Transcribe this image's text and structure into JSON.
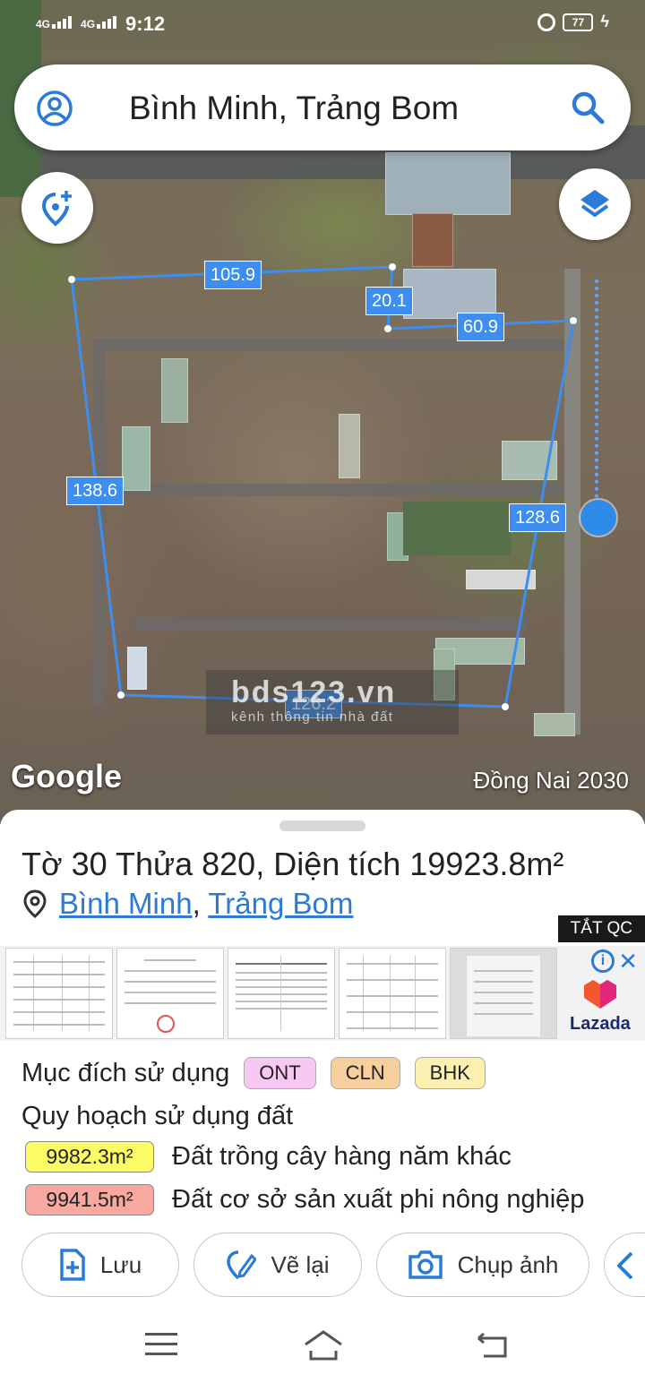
{
  "status": {
    "network1": "4G",
    "network2": "4G",
    "time": "9:12",
    "battery": "77"
  },
  "search": {
    "query": "Bình Minh, Trảng Bom"
  },
  "map": {
    "measurements": [
      "105.9",
      "20.1",
      "60.9",
      "138.6",
      "128.6",
      "126.2"
    ],
    "watermark_main": "bds123.vn",
    "watermark_sub": "kênh thông tin nhà đất",
    "logo": "Google",
    "year_label": "Đồng Nai 2030",
    "boundary_color": "#3d8ef0"
  },
  "parcel": {
    "title": "Tờ 30 Thửa 820, Diện tích 19923.8m²",
    "ward": "Bình Minh",
    "separator": ",",
    "district": "Trảng Bom"
  },
  "ad": {
    "close_label": "TẮT QC",
    "info": "i",
    "brand": "Lazada"
  },
  "land_use": {
    "label": "Mục đích sử dụng",
    "chips": [
      {
        "text": "ONT",
        "color": "#f8c8f2"
      },
      {
        "text": "CLN",
        "color": "#f7cf9c"
      },
      {
        "text": "BHK",
        "color": "#fbf0b0"
      }
    ]
  },
  "planning": {
    "heading": "Quy hoạch sử dụng đất",
    "rows": [
      {
        "area": "9982.3m²",
        "desc": "Đất trồng cây hàng năm khác",
        "color": "#fbfb66"
      },
      {
        "area": "9941.5m²",
        "desc": "Đất cơ sở sản xuất phi nông nghiệp",
        "color": "#f8a89e"
      }
    ]
  },
  "actions": {
    "save": "Lưu",
    "redraw": "Vẽ lại",
    "capture": "Chụp ảnh"
  },
  "icons": [
    "avatar-icon",
    "search-icon",
    "add-location-icon",
    "layers-icon",
    "pin-icon",
    "info-icon",
    "close-icon",
    "save-icon",
    "edit-icon",
    "camera-icon",
    "share-icon",
    "menu-icon",
    "home-icon",
    "back-icon"
  ]
}
